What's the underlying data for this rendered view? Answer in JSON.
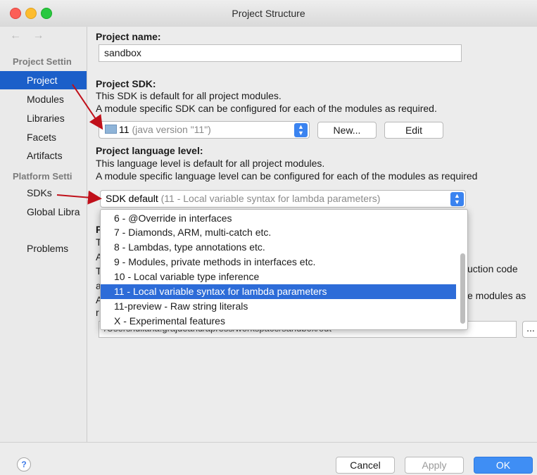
{
  "window": {
    "title": "Project Structure"
  },
  "sidebar": {
    "nav_arrows": "← →",
    "section_project": "Project Settin",
    "items_project": [
      {
        "label": "Project",
        "selected": true
      },
      {
        "label": "Modules"
      },
      {
        "label": "Libraries"
      },
      {
        "label": "Facets"
      },
      {
        "label": "Artifacts"
      }
    ],
    "section_platform": "Platform Setti",
    "items_platform": [
      {
        "label": "SDKs"
      },
      {
        "label": "Global Libra"
      }
    ],
    "problems": "Problems"
  },
  "main": {
    "project_name_label": "Project name:",
    "project_name_value": "sandbox",
    "sdk_label": "Project SDK:",
    "sdk_desc1": "This SDK is default for all project modules.",
    "sdk_desc2": "A module specific SDK can be configured for each of the modules as required.",
    "sdk_value": "11",
    "sdk_version": "(java version \"11\")",
    "new_button": "New...",
    "edit_button": "Edit",
    "lang_label": "Project language level:",
    "lang_desc1": "This language level is default for all project modules.",
    "lang_desc2": "A module specific language level can be configured for each of the modules as required",
    "lang_value": "SDK default",
    "lang_value_detail": "(11 - Local variable syntax for lambda parameters)",
    "dropdown_options": [
      {
        "label": "6 - @Override in interfaces"
      },
      {
        "label": "7 - Diamonds, ARM, multi-catch etc."
      },
      {
        "label": "8 - Lambdas, type annotations etc."
      },
      {
        "label": "9 - Modules, private methods in interfaces etc."
      },
      {
        "label": "10 - Local variable type inference"
      },
      {
        "label": "11 - Local variable syntax for lambda parameters",
        "selected": true
      },
      {
        "label": "11-preview - Raw string literals"
      },
      {
        "label": "X - Experimental features"
      }
    ],
    "obscured_fragment_1": "uction code",
    "obscured_fragment_2": "e modules as",
    "output_path": "/Users/iuliana.grajdeanu/apress/workspace/sandbox/out",
    "browse_button": "...",
    "partial_letters": [
      "P",
      "T",
      "A",
      "T",
      "a",
      "A",
      "r"
    ]
  },
  "footer": {
    "help": "?",
    "cancel": "Cancel",
    "apply": "Apply",
    "ok": "OK"
  },
  "colors": {
    "selection": "#1b5fc9",
    "primary_button": "#3f8ef4",
    "arrow": "#c0101a"
  }
}
